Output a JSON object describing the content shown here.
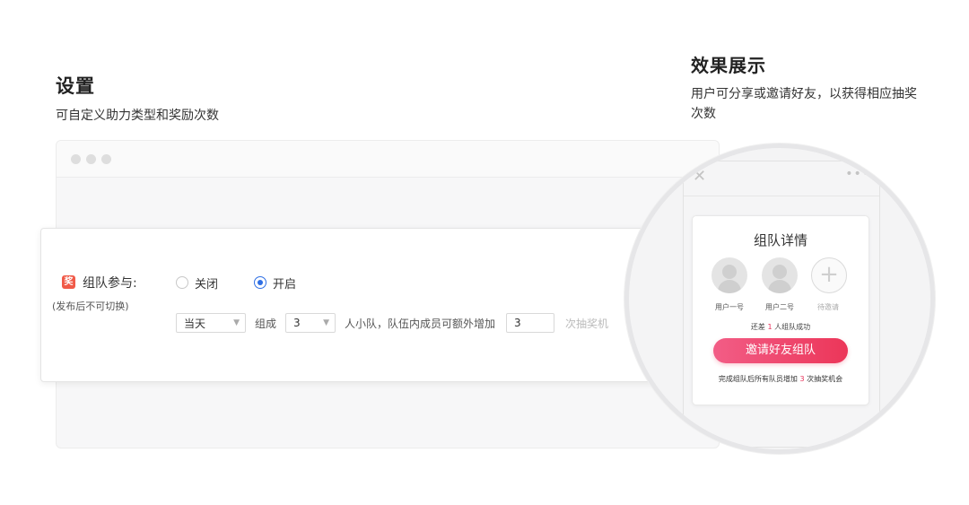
{
  "settings": {
    "title": "设置",
    "subtitle": "可自定义助力类型和奖励次数"
  },
  "config": {
    "icon_glyph": "奖",
    "team_label": "组队参与:",
    "team_note": "(发布后不可切换)",
    "radio_off": "关闭",
    "radio_on": "开启",
    "selected": "开启",
    "period": "当天",
    "group_text": "组成",
    "team_size": "3",
    "middle_text": "人小队，队伍内成员可额外增加",
    "extra_count": "3",
    "tail_text": "次抽奖机"
  },
  "effect": {
    "title": "效果展示",
    "desc": "用户可分享或邀请好友，以获得相应抽奖次数"
  },
  "preview": {
    "close_icon": "close-icon",
    "more_icon": "more-dots-icon",
    "card_title": "组队详情",
    "member_1": "用户一号",
    "member_2": "用户二号",
    "member_3": "待邀请",
    "status_prefix": "还差",
    "status_count": "1",
    "status_suffix": "人组队成功",
    "invite_button": "邀请好友组队",
    "footer_prefix": "完成组队后所有队员增加",
    "footer_count": "3",
    "footer_suffix": "次抽奖机会"
  },
  "colors": {
    "accent_blue": "#2f6fe4",
    "invite_pink": "#ec3659",
    "icon_red": "#f05a48"
  }
}
